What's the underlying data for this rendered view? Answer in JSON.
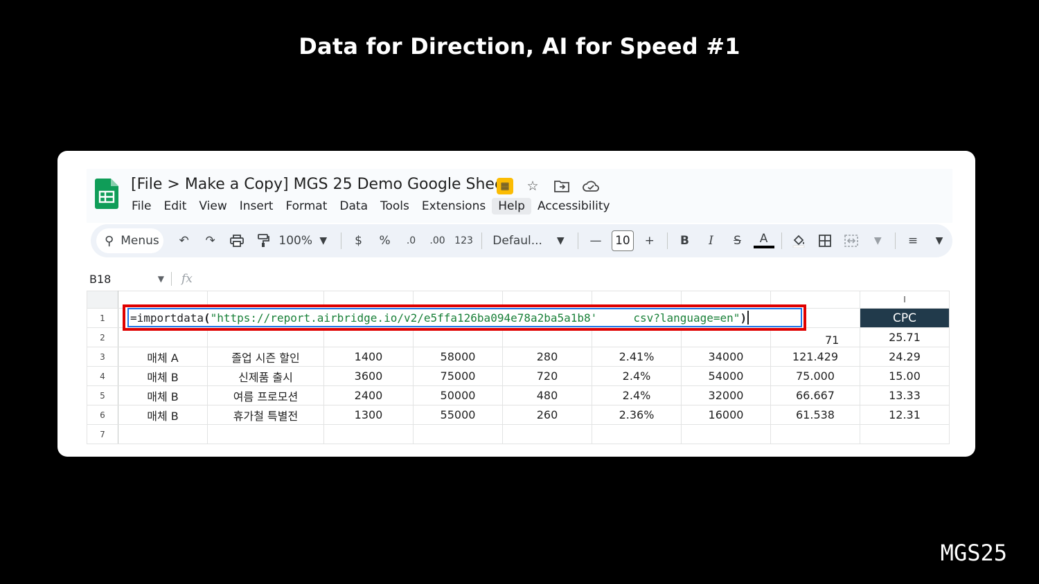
{
  "slide": {
    "title": "Data for Direction, AI for Speed #1",
    "brand": "MGS25"
  },
  "app": {
    "doc_title": "[File > Make a Copy] MGS 25 Demo Google Sheet",
    "title_icons": [
      "no-sync-badge-icon",
      "star-icon",
      "move-to-folder-icon",
      "cloud-status-icon"
    ],
    "menus": [
      "File",
      "Edit",
      "View",
      "Insert",
      "Format",
      "Data",
      "Tools",
      "Extensions",
      "Help",
      "Accessibility"
    ],
    "active_menu": "Help"
  },
  "toolbar": {
    "search_label": "Menus",
    "zoom": "100%",
    "currency": "$",
    "percent": "%",
    "decrease_decimal": ".0",
    "increase_decimal": ".00",
    "number_format": "123",
    "font_name": "Defaul...",
    "font_size": "10",
    "bold": "B",
    "italic": "I",
    "text_color": "A"
  },
  "formula_bar": {
    "cell_ref": "B18",
    "fx": "fx"
  },
  "grid": {
    "column_letter_visible": "I",
    "formula": {
      "prefix": "=importdata",
      "open": "(",
      "str_a": "\"https://report.airbridge.io/v2/e5ffa126ba094e78a2ba5a1b8'",
      "str_b": "csv?language=en\"",
      "close": ")"
    },
    "header_cpc": "CPC",
    "row2_partial": "71",
    "row2_cpc": "25.71",
    "row_numbers": [
      "1",
      "2",
      "3",
      "4",
      "5",
      "6",
      "7"
    ],
    "rows": [
      [
        "매체 A",
        "졸업 시즌 할인",
        "1400",
        "58000",
        "280",
        "2.41%",
        "34000",
        "121.429",
        "24.29"
      ],
      [
        "매체 B",
        "신제품 출시",
        "3600",
        "75000",
        "720",
        "2.4%",
        "54000",
        "75.000",
        "15.00"
      ],
      [
        "매체 B",
        "여름 프로모션",
        "2400",
        "50000",
        "480",
        "2.4%",
        "32000",
        "66.667",
        "13.33"
      ],
      [
        "매체 B",
        "휴가철 특별전",
        "1300",
        "55000",
        "260",
        "2.36%",
        "16000",
        "61.538",
        "12.31"
      ]
    ]
  },
  "colors": {
    "highlight_box": "#e00000",
    "header_cpc_bg": "#213a4b",
    "formula_string": "#188038",
    "sheets_green": "#0f9d58"
  }
}
